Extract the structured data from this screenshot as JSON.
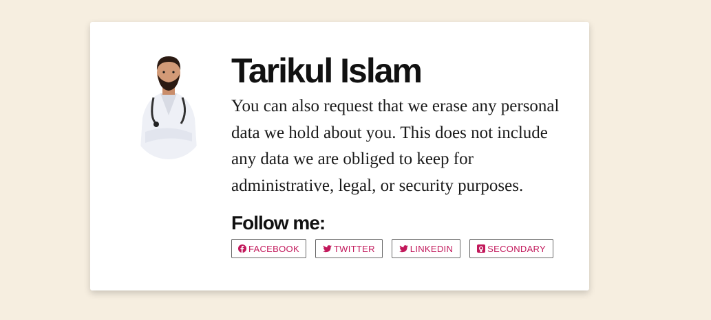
{
  "profile": {
    "name": "Tarikul Islam",
    "bio": "You can also request that we erase any personal data we hold about you. This does not include any data we are obliged to keep for administrative, legal, or security purposes.",
    "avatar_icon": "doctor-avatar"
  },
  "follow": {
    "heading": "Follow me:",
    "buttons": [
      {
        "label": "FACEBOOK",
        "icon": "facebook-icon"
      },
      {
        "label": "TWITTER",
        "icon": "twitter-icon"
      },
      {
        "label": "LINKEDIN",
        "icon": "twitter-icon"
      },
      {
        "label": "SECONDARY",
        "icon": "github-icon"
      }
    ]
  },
  "colors": {
    "page_background": "#f6eee0",
    "card_background": "#ffffff",
    "button_text": "#c2185b",
    "button_border": "#666666"
  }
}
